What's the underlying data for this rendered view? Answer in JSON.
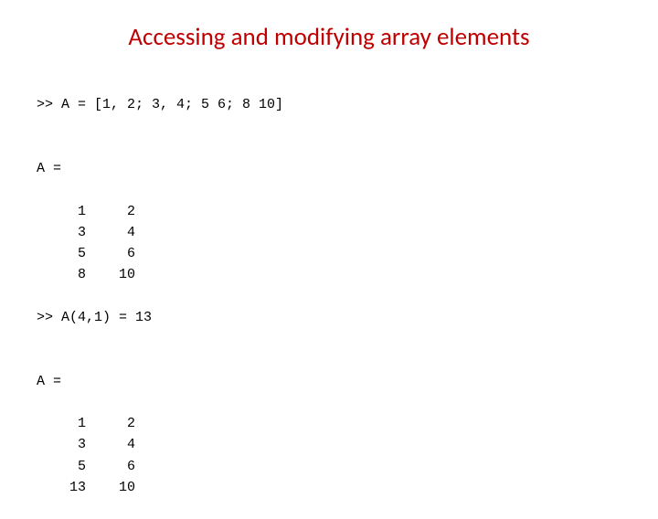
{
  "title": "Accessing and modifying array elements",
  "line1": ">> A = [1, 2; 3, 4; 5 6; 8 10]",
  "blank": "",
  "resA_label": "A =",
  "matrixA": "     1     2\n     3     4\n     5     6\n     8    10",
  "line2": ">> A(4,1) = 13",
  "resB_label": "A =",
  "matrixB": "     1     2\n     3     4\n     5     6\n    13    10"
}
